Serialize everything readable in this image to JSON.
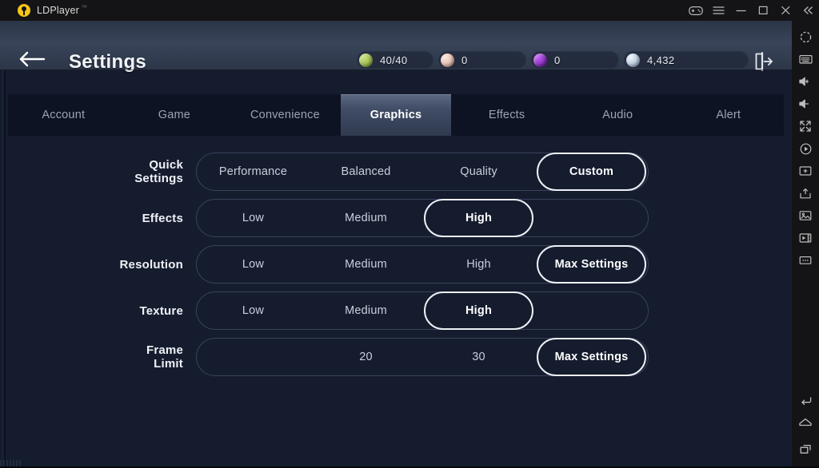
{
  "window": {
    "app_name": "LDPlayer",
    "trademark": "™",
    "controls": [
      {
        "name": "gamepad-icon",
        "label": "Gamepad"
      },
      {
        "name": "menu-icon",
        "label": "Menu"
      },
      {
        "name": "minimize-icon",
        "label": "Minimize"
      },
      {
        "name": "maximize-icon",
        "label": "Maximize"
      },
      {
        "name": "close-icon",
        "label": "Close"
      },
      {
        "name": "collapse-icon",
        "label": "Collapse"
      }
    ]
  },
  "dock": {
    "top_icons": [
      "settings-gear-icon",
      "keyboard-icon",
      "volume-up-icon",
      "volume-down-icon",
      "fullscreen-icon",
      "record-icon",
      "add-instance-icon",
      "install-apk-icon",
      "screenshot-icon",
      "video-icon",
      "more-icon"
    ],
    "bottom_icons": [
      "android-back-icon",
      "android-home-icon",
      "android-recents-icon"
    ]
  },
  "header": {
    "back_label": "Back",
    "title": "Settings",
    "exit_label": "Exit",
    "resources": [
      {
        "name": "energy",
        "value": "40/40",
        "color": "#9dbf4b"
      },
      {
        "name": "currency-pink",
        "value": "0",
        "color": "#e8c6bd"
      },
      {
        "name": "currency-purple",
        "value": "0",
        "color": "#8b2fc9"
      },
      {
        "name": "coins",
        "value": "4,432",
        "color": "#bcd2e8"
      }
    ]
  },
  "tabs": [
    {
      "label": "Account",
      "active": false
    },
    {
      "label": "Game",
      "active": false
    },
    {
      "label": "Convenience",
      "active": false
    },
    {
      "label": "Graphics",
      "active": true
    },
    {
      "label": "Effects",
      "active": false
    },
    {
      "label": "Audio",
      "active": false
    },
    {
      "label": "Alert",
      "active": false
    }
  ],
  "settings": [
    {
      "label_lines": [
        "Quick",
        "Settings"
      ],
      "options": [
        "Performance",
        "Balanced",
        "Quality",
        "Custom"
      ],
      "selected": "Custom"
    },
    {
      "label_lines": [
        "Effects"
      ],
      "options": [
        "Low",
        "Medium",
        "High",
        ""
      ],
      "selected": "High"
    },
    {
      "label_lines": [
        "Resolution"
      ],
      "options": [
        "Low",
        "Medium",
        "High",
        "Max Settings"
      ],
      "selected": "Max Settings"
    },
    {
      "label_lines": [
        "Texture"
      ],
      "options": [
        "Low",
        "Medium",
        "High",
        ""
      ],
      "selected": "High"
    },
    {
      "label_lines": [
        "Frame",
        "Limit"
      ],
      "options": [
        "",
        "20",
        "30",
        "Max Settings"
      ],
      "selected": "Max Settings"
    }
  ]
}
